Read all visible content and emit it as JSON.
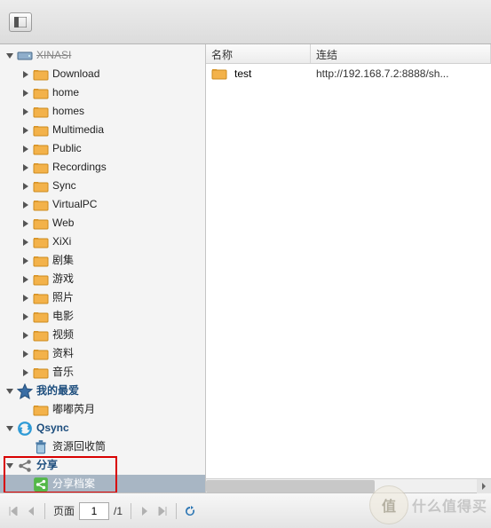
{
  "sidebar": {
    "truncated_volume": "XINASI",
    "folders": [
      "Download",
      "home",
      "homes",
      "Multimedia",
      "Public",
      "Recordings",
      "Sync",
      "VirtualPC",
      "Web",
      "XiXi",
      "剧集",
      "游戏",
      "照片",
      "电影",
      "视频",
      "资料",
      "音乐"
    ],
    "favorites_label": "我的最爱",
    "favorites_items": [
      "嘟嘟芮月"
    ],
    "qsync_label": "Qsync",
    "qsync_items": [
      "资源回收筒"
    ],
    "share_label": "分享",
    "share_items": [
      "分享档案"
    ],
    "recycle_label": "资源回收筒"
  },
  "grid": {
    "col_name": "名称",
    "col_link": "连结",
    "rows": [
      {
        "name": "test",
        "link": "http://192.168.7.2:8888/sh..."
      }
    ]
  },
  "footer": {
    "page_label": "页面",
    "page_value": "1",
    "page_total": "/1"
  },
  "watermark": {
    "circle": "值",
    "text": "什么值得买"
  }
}
